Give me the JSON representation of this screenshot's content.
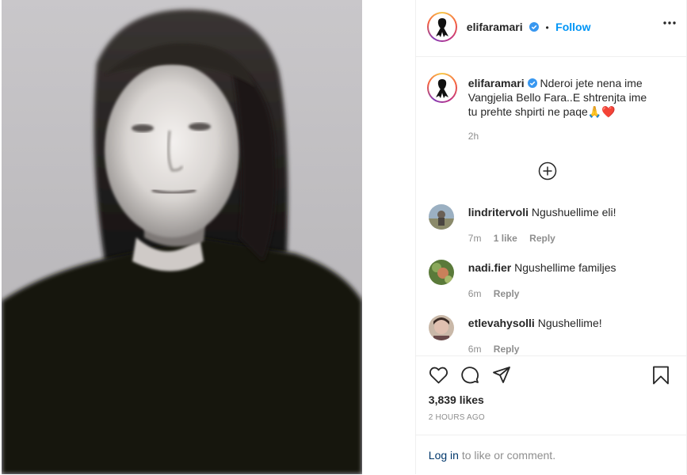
{
  "post": {
    "username": "elifaramari",
    "verified": true,
    "follow_label": "Follow",
    "separator": "•",
    "more_icon": "more-options-icon",
    "caption": "Nderoi jete nena ime Vangjelia Bello Fara..E shtrenjta ime tu prehte shpirti ne paqe🙏❤️",
    "caption_time": "2h",
    "likes": "3,839 likes",
    "posted": "2 HOURS AGO",
    "login_link": "Log in",
    "login_rest": " to like or comment.",
    "load_more_icon": "plus-circle-icon"
  },
  "comments": [
    {
      "user": "lindritervoli",
      "text": " Ngushuellime eli!",
      "time": "7m",
      "likes": "1 like",
      "reply": "Reply"
    },
    {
      "user": "nadi.fier",
      "text": " Ngushellime familjes",
      "time": "6m",
      "likes": "",
      "reply": "Reply"
    },
    {
      "user": "etlevahysolli",
      "text": " Ngushellime!",
      "time": "6m",
      "likes": "",
      "reply": "Reply"
    }
  ],
  "colors": {
    "link_blue": "#0095f6",
    "verified_blue": "#3897f0",
    "muted": "#8e8e8e",
    "text": "#262626"
  }
}
